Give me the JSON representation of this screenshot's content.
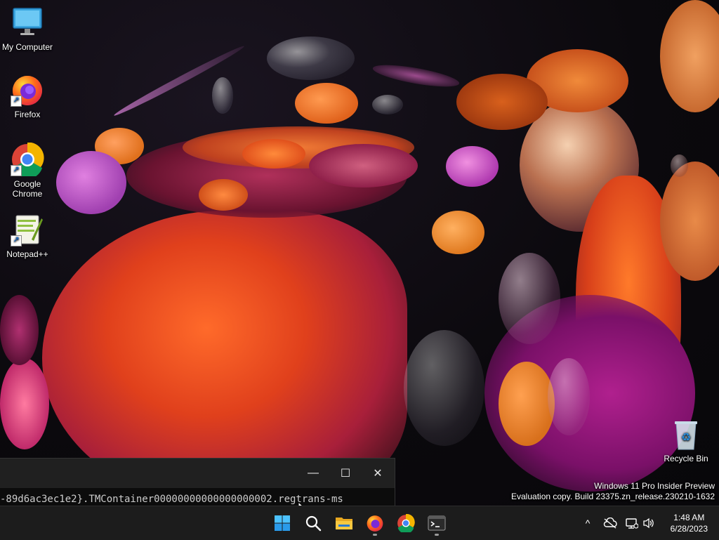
{
  "desktop": {
    "icons": [
      {
        "label": "My Computer",
        "icon": "monitor-icon"
      },
      {
        "label": "Firefox",
        "icon": "firefox-icon"
      },
      {
        "label": "Google Chrome",
        "icon": "chrome-icon"
      },
      {
        "label": "Notepad++",
        "icon": "notepadpp-icon"
      },
      {
        "label": "Recycle Bin",
        "icon": "recycle-bin-icon"
      }
    ],
    "watermark": {
      "line1": "Windows 11 Pro Insider Preview",
      "line2": "Evaluation copy. Build 23375.zn_release.230210-1632"
    }
  },
  "terminal": {
    "text": "-89d6ac3ec1e2}.TMContainer00000000000000000002.regtrans-ms",
    "buttons": {
      "minimize": "—",
      "maximize": "☐",
      "close": "✕"
    }
  },
  "taskbar": {
    "apps": [
      {
        "name": "Start",
        "icon": "windows-start-icon"
      },
      {
        "name": "Search",
        "icon": "search-icon"
      },
      {
        "name": "File Explorer",
        "icon": "folder-icon"
      },
      {
        "name": "Firefox",
        "icon": "firefox-icon",
        "running": true
      },
      {
        "name": "Google Chrome",
        "icon": "chrome-icon"
      },
      {
        "name": "Terminal",
        "icon": "terminal-icon",
        "running": true
      }
    ],
    "tray": {
      "chevron": "^",
      "time": "1:48 AM",
      "date": "6/28/2023"
    }
  },
  "colors": {
    "taskbar_bg": "#1c1c1c",
    "titlebar_bg": "#202020",
    "terminal_bg": "#0c0c0c",
    "accent_orange": "#e8611a",
    "accent_magenta": "#c03aa8"
  }
}
